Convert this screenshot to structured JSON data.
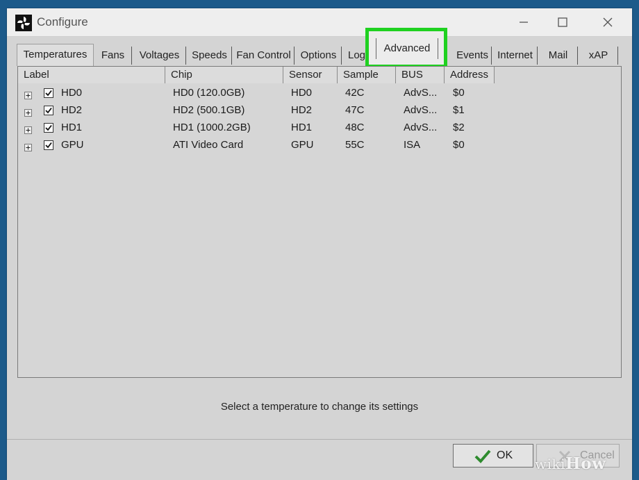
{
  "window": {
    "title": "Configure"
  },
  "tabs": [
    {
      "label": "Temperatures"
    },
    {
      "label": "Fans"
    },
    {
      "label": "Voltages"
    },
    {
      "label": "Speeds"
    },
    {
      "label": "Fan Control"
    },
    {
      "label": "Options"
    },
    {
      "label": "Log"
    },
    {
      "label": "Advanced"
    },
    {
      "label": "Events"
    },
    {
      "label": "Internet"
    },
    {
      "label": "Mail"
    },
    {
      "label": "xAP"
    }
  ],
  "table": {
    "columns": [
      "Label",
      "Chip",
      "Sensor",
      "Sample",
      "BUS",
      "Address"
    ],
    "rows": [
      {
        "label": "HD0",
        "chip": "HD0 (120.0GB)",
        "sensor": "HD0",
        "sample": "42C",
        "bus": "AdvS...",
        "address": "$0",
        "checked": true
      },
      {
        "label": "HD2",
        "chip": "HD2 (500.1GB)",
        "sensor": "HD2",
        "sample": "47C",
        "bus": "AdvS...",
        "address": "$1",
        "checked": true
      },
      {
        "label": "HD1",
        "chip": "HD1 (1000.2GB)",
        "sensor": "HD1",
        "sample": "48C",
        "bus": "AdvS...",
        "address": "$2",
        "checked": true
      },
      {
        "label": "GPU",
        "chip": "ATI Video Card",
        "sensor": "GPU",
        "sample": "55C",
        "bus": "ISA",
        "address": "$0",
        "checked": true
      }
    ]
  },
  "status_text": "Select a temperature to change its settings",
  "buttons": {
    "ok": "OK",
    "cancel": "Cancel"
  },
  "watermark": {
    "prefix": "wiki",
    "suffix": "How"
  },
  "colors": {
    "highlight": "#1fd120",
    "ok_check": "#2e8b2e",
    "cancel_x": "#c0392b"
  }
}
